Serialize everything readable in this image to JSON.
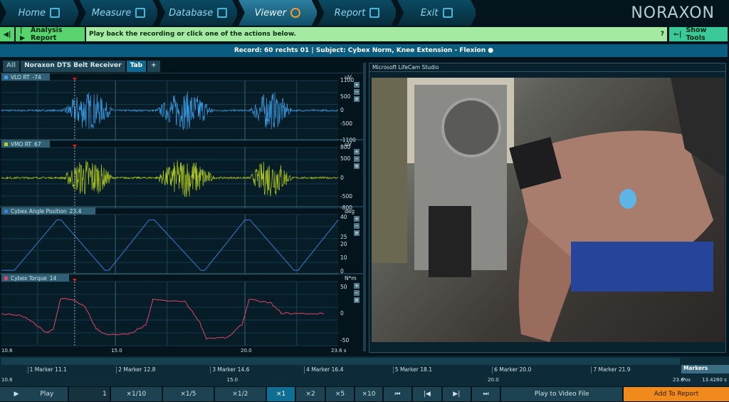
{
  "nav": {
    "tabs": [
      {
        "label": "Home",
        "icon": "home-icon"
      },
      {
        "label": "Measure",
        "icon": "measure-icon"
      },
      {
        "label": "Database",
        "icon": "database-icon"
      },
      {
        "label": "Viewer",
        "icon": "viewer-icon",
        "active": true
      },
      {
        "label": "Report",
        "icon": "report-icon"
      },
      {
        "label": "Exit",
        "icon": "exit-icon"
      }
    ],
    "logo": "NORAXON"
  },
  "actionbar": {
    "back": "◀|",
    "analysis_icon": "|▶",
    "analysis": "Analysis Report",
    "message": "Play back the recording or click one of the actions below.",
    "help": "?",
    "show_tools_icon": "←|",
    "show_tools": "Show Tools"
  },
  "record": "Record: 60 rechts 01 | Subject: Cybex Norm, Knee Extension - Flexion ●",
  "channel_tabs": [
    "All",
    "Noraxon DTS Belt Receiver",
    "Tab",
    "+"
  ],
  "channels": [
    {
      "name": "VLO RT",
      "value": "-74",
      "unit": "uV",
      "color": "#3a9ee8",
      "ticks": [
        "1100",
        "500",
        "0",
        "-500",
        "-1100"
      ]
    },
    {
      "name": "VMO RT",
      "value": "67",
      "unit": "uV",
      "color": "#b6cc1c",
      "ticks": [
        "800",
        "500",
        "0",
        "-500",
        "-800"
      ]
    },
    {
      "name": "Cybex Angle Position",
      "value": "23.4",
      "unit": "deg",
      "color": "#3a7ed8",
      "ticks": [
        "40",
        "25",
        "20",
        "10",
        "0"
      ]
    },
    {
      "name": "Cybex Torque",
      "value": "14",
      "unit": "N*m",
      "color": "#e0466a",
      "ticks": [
        "50",
        "0",
        "-50"
      ]
    }
  ],
  "signals": {
    "time_range_s": [
      10.6,
      23.6
    ],
    "emg_bursts_s": [
      [
        13.0,
        14.9
      ],
      [
        16.6,
        18.8
      ],
      [
        20.2,
        21.8
      ]
    ],
    "angle_deg": [
      [
        10.6,
        1
      ],
      [
        11.1,
        1
      ],
      [
        12.74,
        38
      ],
      [
        12.9,
        38
      ],
      [
        14.6,
        1
      ],
      [
        14.75,
        1
      ],
      [
        16.3,
        38
      ],
      [
        16.5,
        38
      ],
      [
        18.3,
        1
      ],
      [
        18.45,
        1
      ],
      [
        20.0,
        38
      ],
      [
        20.2,
        38
      ],
      [
        21.9,
        1
      ],
      [
        22.05,
        1
      ],
      [
        23.6,
        38
      ]
    ],
    "torque_nm": [
      [
        10.6,
        0
      ],
      [
        11.37,
        -4
      ],
      [
        11.78,
        -15
      ],
      [
        12.33,
        -36
      ],
      [
        12.6,
        -30
      ],
      [
        12.88,
        28
      ],
      [
        13.29,
        27
      ],
      [
        13.84,
        12
      ],
      [
        14.25,
        -28
      ],
      [
        14.67,
        -40
      ],
      [
        15.49,
        -39
      ],
      [
        16.18,
        -22
      ],
      [
        16.45,
        26
      ],
      [
        17.69,
        22
      ],
      [
        18.24,
        -15
      ],
      [
        18.51,
        -46
      ],
      [
        19.34,
        -45
      ],
      [
        19.89,
        -20
      ],
      [
        20.16,
        26
      ],
      [
        20.99,
        20
      ],
      [
        21.4,
        1
      ],
      [
        22.09,
        0
      ],
      [
        23.19,
        0
      ]
    ]
  },
  "cursor_time": 13.428,
  "plot_axis": {
    "ticks": [
      "10.6",
      "15.0",
      "20.0",
      "23.6 s"
    ]
  },
  "video": {
    "title": "Microsoft LifeCam Studio"
  },
  "markers": {
    "label": "Markers",
    "items": [
      {
        "label": "1 Marker 11.1",
        "t": 11.1
      },
      {
        "label": "2 Marker 12.8",
        "t": 12.8
      },
      {
        "label": "3 Marker 14.6",
        "t": 14.6
      },
      {
        "label": "4 Marker 16.4",
        "t": 16.4
      },
      {
        "label": "5 Marker 18.1",
        "t": 18.1
      },
      {
        "label": "6 Marker 20.0",
        "t": 20.0
      },
      {
        "label": "7 Marker 21.9",
        "t": 21.9
      }
    ],
    "axis": [
      "10.6",
      "15.0",
      "20.0",
      "23.6"
    ],
    "pos_label": "Pos",
    "pos_value": "13.4280 s"
  },
  "controls": {
    "play": "Play",
    "frame": "1",
    "speeds": [
      "×1/10",
      "×1/5",
      "×1/2",
      "×1",
      "×2",
      "×5",
      "×10"
    ],
    "active_speed": "×1",
    "transport": [
      "⏮",
      "|◀",
      "▶|",
      "⏭"
    ],
    "play_to_video": "Play to Video File",
    "add_to_report": "Add To Report"
  },
  "colors": {
    "accent": "#0e6e93",
    "green": "#58d36d",
    "orange": "#f08a1c"
  }
}
